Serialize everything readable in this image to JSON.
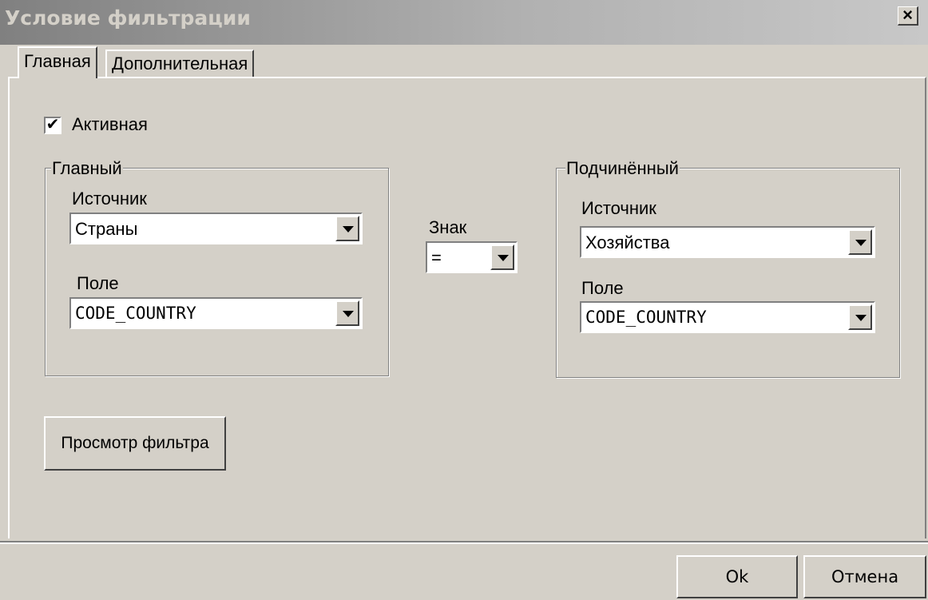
{
  "window": {
    "title": "Условие фильтрации",
    "close_label": "×"
  },
  "tabs": [
    {
      "label": "Главная",
      "active": true
    },
    {
      "label": "Дополнительная",
      "active": false
    }
  ],
  "active_checkbox": {
    "label": "Активная",
    "checked": true,
    "mark": "✔"
  },
  "main_group": {
    "legend": "Главный",
    "source_label": "Источник",
    "source_value": "Страны",
    "field_label": "Поле",
    "field_value": "CODE_COUNTRY"
  },
  "sign": {
    "label": "Знак",
    "value": "="
  },
  "sub_group": {
    "legend": "Подчинённый",
    "source_label": "Источник",
    "source_value": "Хозяйства",
    "field_label": "Поле",
    "field_value": "CODE_COUNTRY"
  },
  "buttons": {
    "preview": "Просмотр фильтра",
    "ok": "Ok",
    "cancel": "Отмена"
  }
}
